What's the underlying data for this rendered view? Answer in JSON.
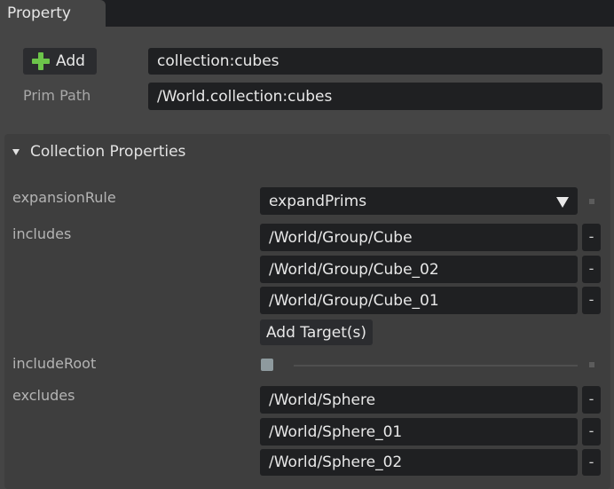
{
  "tab": {
    "title": "Property"
  },
  "header": {
    "add_label": "Add",
    "name_value": "collection:cubes",
    "prim_path_label": "Prim Path",
    "prim_path_value": "/World.collection:cubes"
  },
  "collection": {
    "title": "Collection Properties",
    "expansion_rule": {
      "label": "expansionRule",
      "value": "expandPrims"
    },
    "includes": {
      "label": "includes",
      "items": [
        "/World/Group/Cube",
        "/World/Group/Cube_02",
        "/World/Group/Cube_01"
      ],
      "add_target_label": "Add Target(s)"
    },
    "include_root": {
      "label": "includeRoot",
      "checked": false
    },
    "excludes": {
      "label": "excludes",
      "items": [
        "/World/Sphere",
        "/World/Sphere_01",
        "/World/Sphere_02"
      ]
    },
    "remove_label": "-"
  },
  "colors": {
    "accent_green": "#6cc44a",
    "field_bg": "#1f2022",
    "panel_bg": "#3e3e3e"
  },
  "icons": {
    "add": "plus-icon",
    "expand": "triangle-down-icon",
    "dropdown": "dropdown-arrow-icon"
  }
}
